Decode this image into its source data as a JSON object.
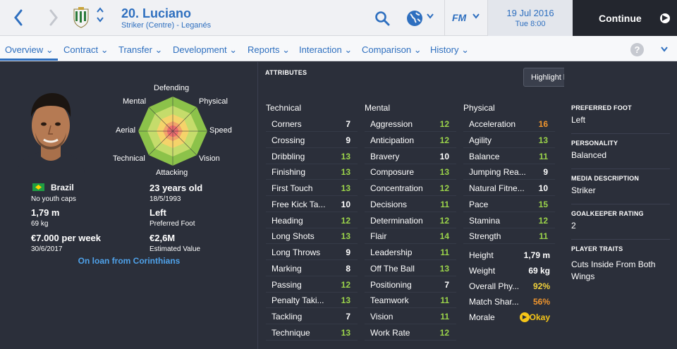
{
  "header": {
    "player_name": "20. Luciano",
    "player_subtitle": "Striker (Centre) - Leganés",
    "date": "19 Jul 2016",
    "time": "Tue 8:00",
    "fm_label": "FM",
    "continue_label": "Continue"
  },
  "menu": [
    "Overview",
    "Contract",
    "Transfer",
    "Development",
    "Reports",
    "Interaction",
    "Comparison",
    "History"
  ],
  "profile": {
    "radar_labels": {
      "top": "Defending",
      "top_left": "Mental",
      "top_right": "Physical",
      "left": "Aerial",
      "right": "Speed",
      "bottom_left": "Technical",
      "bottom_right": "Vision",
      "bottom": "Attacking"
    },
    "nationality": "Brazil",
    "youth_caps": "No youth caps",
    "height": "1,79 m",
    "weight": "69 kg",
    "wage": "€7.000 per week",
    "contract_end": "30/6/2017",
    "age": "23 years old",
    "dob": "18/5/1993",
    "foot": "Left",
    "foot_label": "Preferred Foot",
    "value": "€2,6M",
    "value_label": "Estimated Value",
    "loan_text": "On loan from Corinthians"
  },
  "attributes": {
    "title": "ATTRIBUTES",
    "highlight_label": "Highlight key attributes for role",
    "columns": [
      {
        "header": "Technical",
        "items": [
          {
            "name": "Corners",
            "value": "7"
          },
          {
            "name": "Crossing",
            "value": "9"
          },
          {
            "name": "Dribbling",
            "value": "13"
          },
          {
            "name": "Finishing",
            "value": "13"
          },
          {
            "name": "First Touch",
            "value": "13"
          },
          {
            "name": "Free Kick Ta...",
            "value": "10"
          },
          {
            "name": "Heading",
            "value": "12"
          },
          {
            "name": "Long Shots",
            "value": "13"
          },
          {
            "name": "Long Throws",
            "value": "9"
          },
          {
            "name": "Marking",
            "value": "8"
          },
          {
            "name": "Passing",
            "value": "12"
          },
          {
            "name": "Penalty Taki...",
            "value": "13"
          },
          {
            "name": "Tackling",
            "value": "7"
          },
          {
            "name": "Technique",
            "value": "13"
          }
        ]
      },
      {
        "header": "Mental",
        "items": [
          {
            "name": "Aggression",
            "value": "12"
          },
          {
            "name": "Anticipation",
            "value": "12"
          },
          {
            "name": "Bravery",
            "value": "10"
          },
          {
            "name": "Composure",
            "value": "13"
          },
          {
            "name": "Concentration",
            "value": "12"
          },
          {
            "name": "Decisions",
            "value": "11"
          },
          {
            "name": "Determination",
            "value": "12"
          },
          {
            "name": "Flair",
            "value": "14"
          },
          {
            "name": "Leadership",
            "value": "11"
          },
          {
            "name": "Off The Ball",
            "value": "13"
          },
          {
            "name": "Positioning",
            "value": "7"
          },
          {
            "name": "Teamwork",
            "value": "11"
          },
          {
            "name": "Vision",
            "value": "11"
          },
          {
            "name": "Work Rate",
            "value": "12"
          }
        ]
      },
      {
        "header": "Physical",
        "items": [
          {
            "name": "Acceleration",
            "value": "16"
          },
          {
            "name": "Agility",
            "value": "13"
          },
          {
            "name": "Balance",
            "value": "11"
          },
          {
            "name": "Jumping Rea...",
            "value": "9"
          },
          {
            "name": "Natural Fitne...",
            "value": "10"
          },
          {
            "name": "Pace",
            "value": "15"
          },
          {
            "name": "Stamina",
            "value": "12"
          },
          {
            "name": "Strength",
            "value": "11"
          }
        ]
      }
    ],
    "extra": [
      {
        "name": "Height",
        "value": "1,79 m"
      },
      {
        "name": "Weight",
        "value": "69 kg"
      },
      {
        "name": "Overall Phy...",
        "value": "92%"
      },
      {
        "name": "Match Shar...",
        "value": "56%"
      },
      {
        "name": "Morale",
        "value": "Okay"
      }
    ]
  },
  "details": [
    {
      "label": "PREFERRED FOOT",
      "value": "Left"
    },
    {
      "label": "PERSONALITY",
      "value": "Balanced"
    },
    {
      "label": "MEDIA DESCRIPTION",
      "value": "Striker"
    },
    {
      "label": "GOALKEEPER RATING",
      "value": "2"
    },
    {
      "label": "PLAYER TRAITS",
      "value": "Cuts Inside From Both Wings"
    }
  ],
  "colors": {
    "accent_blue": "#2e6fbf",
    "value_white": "#ffffff",
    "value_green": "#9bd34a",
    "value_orange": "#f0952d",
    "value_yellow": "#f2d23a",
    "morale_yellow": "#f5c518"
  }
}
